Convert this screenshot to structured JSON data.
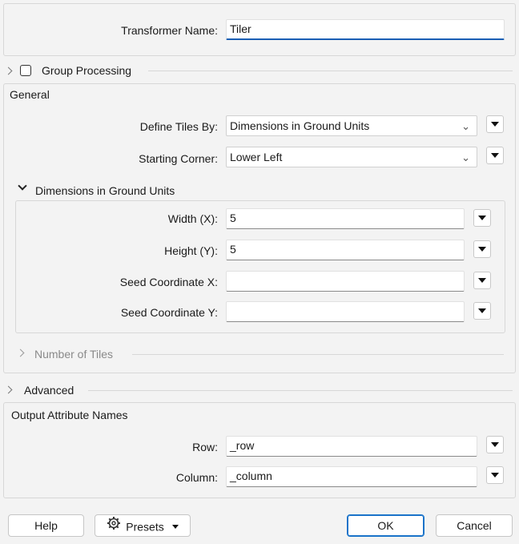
{
  "transformer": {
    "name_label": "Transformer Name:",
    "name_value": "Tiler"
  },
  "group_processing": {
    "label": "Group Processing"
  },
  "general": {
    "title": "General",
    "define_tiles_label": "Define Tiles By:",
    "define_tiles_value": "Dimensions in Ground Units",
    "starting_corner_label": "Starting Corner:",
    "starting_corner_value": "Lower Left",
    "dimensions": {
      "title": "Dimensions in Ground Units",
      "width_label": "Width (X):",
      "width_value": "5",
      "height_label": "Height (Y):",
      "height_value": "5",
      "seed_x_label": "Seed Coordinate X:",
      "seed_x_value": "",
      "seed_y_label": "Seed Coordinate Y:",
      "seed_y_value": ""
    },
    "number_of_tiles": {
      "title": "Number of Tiles"
    }
  },
  "advanced": {
    "title": "Advanced"
  },
  "output": {
    "title": "Output Attribute Names",
    "row_label": "Row:",
    "row_value": "_row",
    "column_label": "Column:",
    "column_value": "_column"
  },
  "footer": {
    "help": "Help",
    "presets": "Presets",
    "ok": "OK",
    "cancel": "Cancel"
  },
  "icons": {
    "presets_icon": "gear-icon",
    "menu_icon": "triangle-down-icon"
  }
}
